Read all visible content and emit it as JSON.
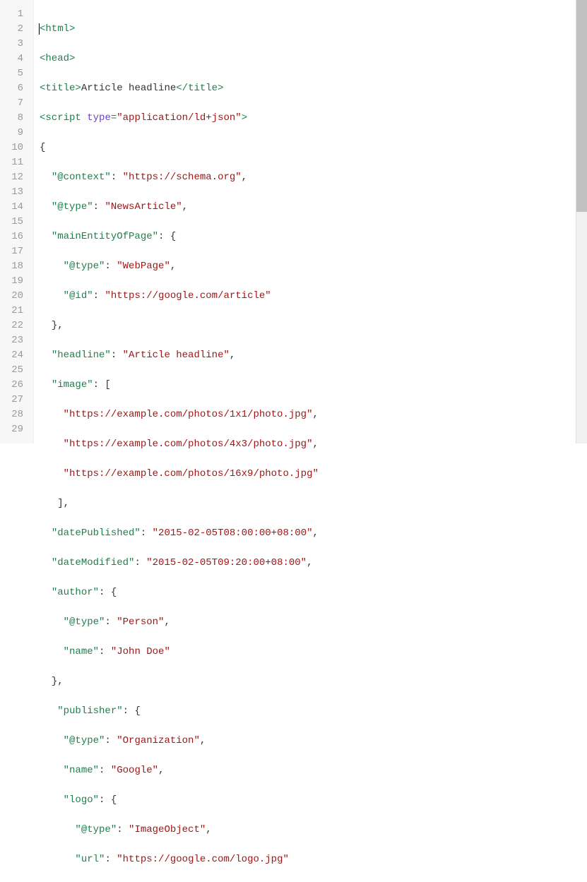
{
  "lines": {
    "count": 29,
    "l1": {
      "tag": "html"
    },
    "l2": {
      "tag": "head"
    },
    "l3": {
      "open": "title",
      "text": "Article headline",
      "close": "title"
    },
    "l4": {
      "tag": "script",
      "attr": "type",
      "val": "\"application/ld+json\""
    },
    "l5": {
      "raw": "{"
    },
    "l6": {
      "key": "\"@context\"",
      "val": "\"https://schema.org\"",
      "comma": ","
    },
    "l7": {
      "key": "\"@type\"",
      "val": "\"NewsArticle\"",
      "comma": ","
    },
    "l8": {
      "key": "\"mainEntityOfPage\"",
      "after": ": {"
    },
    "l9": {
      "key": "\"@type\"",
      "val": "\"WebPage\"",
      "comma": ","
    },
    "l10": {
      "key": "\"@id\"",
      "val": "\"https://google.com/article\""
    },
    "l11": {
      "raw": "},"
    },
    "l12": {
      "key": "\"headline\"",
      "val": "\"Article headline\"",
      "comma": ","
    },
    "l13": {
      "key": "\"image\"",
      "after": ": ["
    },
    "l14": {
      "val": "\"https://example.com/photos/1x1/photo.jpg\"",
      "comma": ","
    },
    "l15": {
      "val": "\"https://example.com/photos/4x3/photo.jpg\"",
      "comma": ","
    },
    "l16": {
      "val": "\"https://example.com/photos/16x9/photo.jpg\""
    },
    "l17": {
      "raw": " ],"
    },
    "l18": {
      "key": "\"datePublished\"",
      "val": "\"2015-02-05T08:00:00+08:00\"",
      "comma": ","
    },
    "l19": {
      "key": "\"dateModified\"",
      "val": "\"2015-02-05T09:20:00+08:00\"",
      "comma": ","
    },
    "l20": {
      "key": "\"author\"",
      "after": ": {"
    },
    "l21": {
      "key": "\"@type\"",
      "val": "\"Person\"",
      "comma": ","
    },
    "l22": {
      "key": "\"name\"",
      "val": "\"John Doe\""
    },
    "l23": {
      "raw": "},"
    },
    "l24": {
      "key": "\"publisher\"",
      "after": ": {"
    },
    "l25": {
      "key": "\"@type\"",
      "val": "\"Organization\"",
      "comma": ","
    },
    "l26": {
      "key": "\"name\"",
      "val": "\"Google\"",
      "comma": ","
    },
    "l27": {
      "key": "\"logo\"",
      "after": ": {"
    },
    "l28": {
      "key": "\"@type\"",
      "val": "\"ImageObject\"",
      "comma": ","
    },
    "l29": {
      "key": "\"url\"",
      "val": "\"https://google.com/logo.jpg\""
    }
  },
  "indents": {
    "l1": "",
    "l2": "",
    "l3": "",
    "l4": "",
    "l5": "",
    "l6": "  ",
    "l7": "  ",
    "l8": "  ",
    "l9": "    ",
    "l10": "    ",
    "l11": "  ",
    "l12": "  ",
    "l13": "  ",
    "l14": "    ",
    "l15": "    ",
    "l16": "    ",
    "l17": "  ",
    "l18": "  ",
    "l19": "  ",
    "l20": "  ",
    "l21": "    ",
    "l22": "    ",
    "l23": "  ",
    "l24": "   ",
    "l25": "    ",
    "l26": "    ",
    "l27": "    ",
    "l28": "      ",
    "l29": "      "
  }
}
